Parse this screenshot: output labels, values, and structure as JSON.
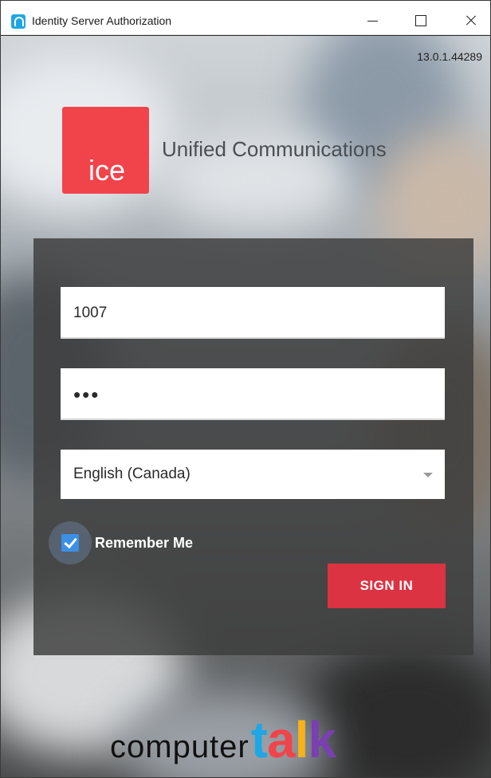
{
  "window": {
    "title": "Identity Server Authorization",
    "controls": [
      "minimize",
      "maximize",
      "close"
    ]
  },
  "version": "13.0.1.44289",
  "logo": {
    "mark_text": "ice",
    "product_name": "Unified Communications",
    "accent": "#f1444a"
  },
  "form": {
    "username_value": "1007",
    "password_value": "•••",
    "language_value": "English (Canada)",
    "remember_label": "Remember Me",
    "remember_checked": true,
    "signin_label": "SIGN IN",
    "signin_color": "#dc3342"
  },
  "footer": {
    "brand_part1": "computer",
    "brand_part2_letters": [
      "t",
      "a",
      "l",
      "k"
    ],
    "brand_colors": [
      "#1ea7e4",
      "#f1444a",
      "#f6b21a",
      "#7a3fb0"
    ]
  }
}
